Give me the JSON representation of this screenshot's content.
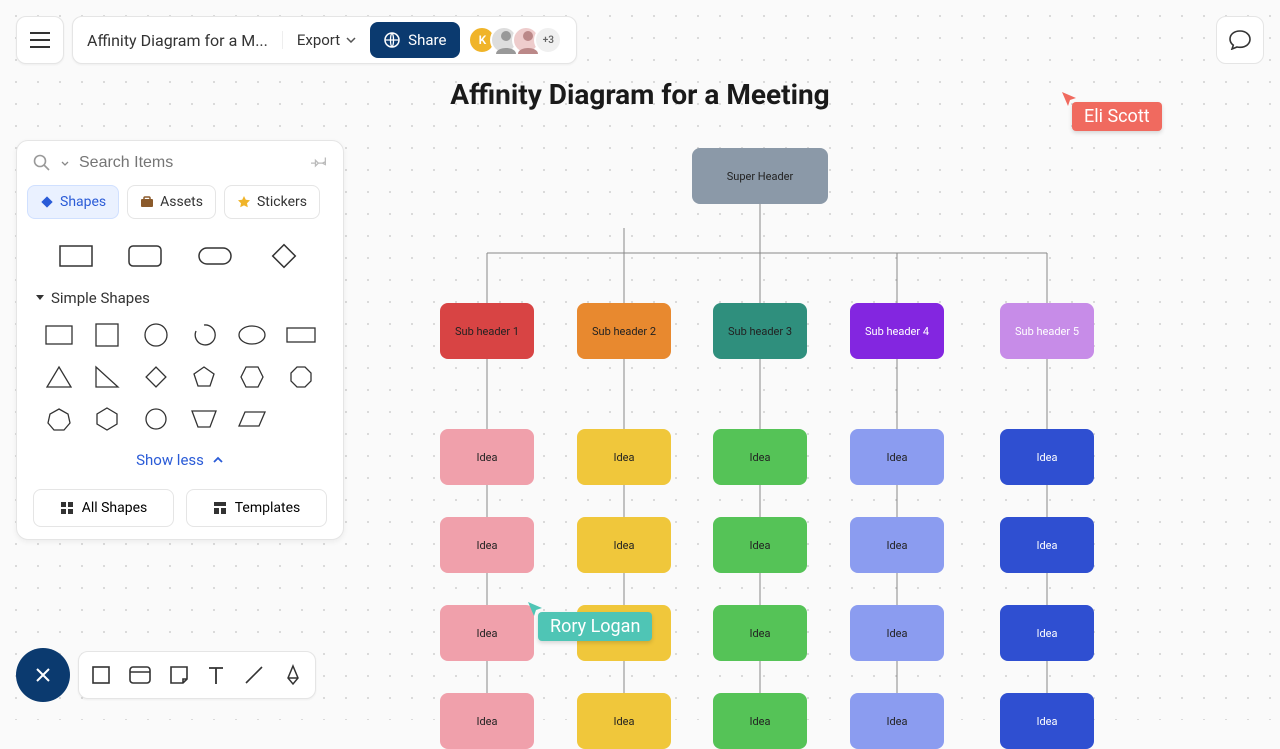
{
  "header": {
    "doc_title": "Affinity Diagram for a M...",
    "export_label": "Export",
    "share_label": "Share",
    "avatar_more": "+3"
  },
  "sidebar": {
    "search_placeholder": "Search Items",
    "tabs": {
      "shapes": "Shapes",
      "assets": "Assets",
      "stickers": "Stickers"
    },
    "category": "Simple Shapes",
    "show_less": "Show less",
    "all_shapes": "All Shapes",
    "templates": "Templates"
  },
  "canvas": {
    "title": "Affinity Diagram for a Meeting",
    "super_header": "Super Header",
    "sub_headers": [
      "Sub header 1",
      "Sub header 2",
      "Sub header 3",
      "Sub header 4",
      "Sub header 5"
    ],
    "idea_label": "Idea",
    "colors": {
      "super": "#8b99a8",
      "subs": [
        "#d84444",
        "#e8892f",
        "#2f8f7d",
        "#8326e0",
        "#c78ce8"
      ],
      "ideas": [
        "#f0a0ab",
        "#f0c73b",
        "#55c357",
        "#8b9cf0",
        "#2f4fd1"
      ]
    }
  },
  "cursors": {
    "eli": {
      "name": "Eli Scott",
      "color": "#f06a5f"
    },
    "rory": {
      "name": "Rory Logan",
      "color": "#4fc5b5"
    }
  }
}
